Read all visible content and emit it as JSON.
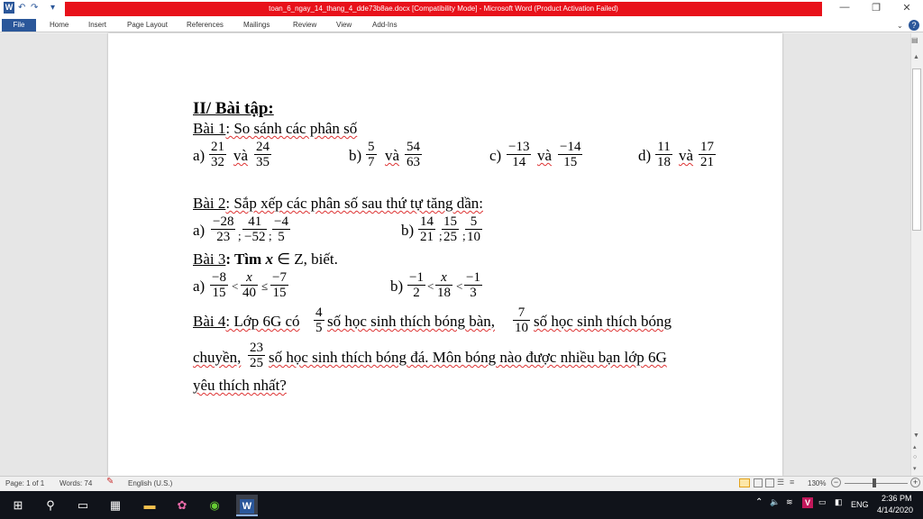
{
  "window": {
    "title": "toan_6_ngay_14_thang_4_dde73b8ae.docx [Compatibility Mode] - Microsoft Word (Product Activation Failed)",
    "minimize": "—",
    "restore": "❐",
    "close": "✕"
  },
  "quick_access": {
    "word": "W",
    "undo": "↶",
    "redo": "↷",
    "custom": "▾"
  },
  "ribbon": {
    "tabs": [
      "File",
      "Home",
      "Insert",
      "Page Layout",
      "References",
      "Mailings",
      "Review",
      "View",
      "Add-Ins"
    ],
    "help": "?"
  },
  "document": {
    "heading": "II/ Bài tập:",
    "b1": {
      "label": "Bài 1",
      "text": ": So sánh các phân số",
      "items": [
        {
          "letter": "a)",
          "f1": [
            "21",
            "32"
          ],
          "and": "và",
          "f2": [
            "24",
            "35"
          ]
        },
        {
          "letter": "b)",
          "f1": [
            "5",
            "7"
          ],
          "and": "và",
          "f2": [
            "54",
            "63"
          ]
        },
        {
          "letter": "c)",
          "f1": [
            "−13",
            "14"
          ],
          "and": "và",
          "f2": [
            "−14",
            "15"
          ]
        },
        {
          "letter": "d)",
          "f1": [
            "11",
            "18"
          ],
          "and": "và",
          "f2": [
            "17",
            "21"
          ]
        }
      ]
    },
    "b2": {
      "label": "Bài 2",
      "text": ": Sắp xếp các phân số sau thứ tự tăng dần:",
      "a": {
        "letter": "a)",
        "f": [
          [
            "−28",
            "23"
          ],
          [
            "41",
            "−52"
          ],
          [
            "−4",
            "5"
          ]
        ]
      },
      "b": {
        "letter": "b)",
        "f": [
          [
            "14",
            "21"
          ],
          [
            "15",
            "25"
          ],
          [
            "5",
            "10"
          ]
        ]
      }
    },
    "b3": {
      "label": "Bài 3",
      "text_a": ": Tìm ",
      "text_x": "x",
      "text_b": " ∈ Z, biết.",
      "a": {
        "letter": "a)",
        "f": [
          [
            "−8",
            "15"
          ],
          [
            "x",
            "40"
          ],
          [
            "−7",
            "15"
          ]
        ],
        "ops": [
          "<",
          "≤"
        ]
      },
      "b": {
        "letter": "b)",
        "f": [
          [
            "−1",
            "2"
          ],
          [
            "x",
            "18"
          ],
          [
            "−1",
            "3"
          ]
        ],
        "ops": [
          "<",
          "<"
        ]
      }
    },
    "b4": {
      "label": "Bài 4",
      "t1": ": Lớp 6G có ",
      "f1": [
        "4",
        "5"
      ],
      "t2": " số học sinh thích bóng bàn, ",
      "f2": [
        "7",
        "10"
      ],
      "t3": "số học sinh thích bóng",
      "t4": "chuyền, ",
      "f3": [
        "23",
        "25"
      ],
      "t5": "số học sinh thích bóng đá. Môn bóng nào được nhiều bạn lớp 6G",
      "t6": "yêu thích nhất?"
    }
  },
  "status": {
    "page": "Page: 1 of 1",
    "words": "Words: 74",
    "language": "English (U.S.)",
    "zoom": "130%"
  },
  "tray": {
    "lang": "ENG",
    "time": "2:36 PM",
    "date": "4/14/2020"
  }
}
